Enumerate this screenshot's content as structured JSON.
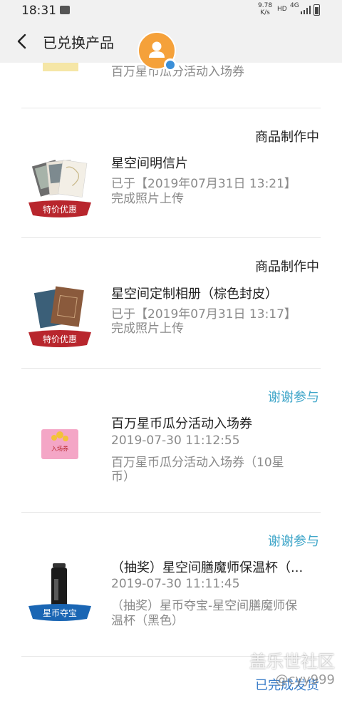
{
  "status_bar": {
    "time": "18:31",
    "speed_value": "9.78",
    "speed_unit": "K/s",
    "hd": "HD",
    "network": "4G"
  },
  "header": {
    "title": "已兑换产品"
  },
  "items": [
    {
      "line": "百万星币瓜分活动入场券"
    },
    {
      "status": "商品制作中",
      "title": "星空间明信片",
      "line1": "已于【2019年07月31日 13:21】",
      "line2": "完成照片上传",
      "badge": "特价优惠"
    },
    {
      "status": "商品制作中",
      "title": "星空间定制相册（棕色封皮）",
      "line1": "已于【2019年07月31日 13:17】",
      "line2": "完成照片上传",
      "badge": "特价优惠"
    },
    {
      "status": "谢谢参与",
      "title": "百万星币瓜分活动入场券",
      "date": "2019-07-30 11:12:55",
      "line1": "百万星币瓜分活动入场券（10星",
      "line2": "币）",
      "ticket_text": "入场券"
    },
    {
      "status": "谢谢参与",
      "title": "（抽奖）星空间膳魔师保温杯（...",
      "date": "2019-07-30 11:11:45",
      "line1": "（抽奖）星币夺宝-星空间膳魔师保",
      "line2": "温杯（黑色）",
      "badge": "星币夺宝"
    },
    {
      "status": "已完成发货"
    }
  ],
  "watermark": {
    "line1": "盖乐世社区",
    "line2": "@cyy999"
  },
  "colors": {
    "header_bg": "#f1f1f1",
    "badge_red": "#b8262d",
    "badge_blue": "#1a66b4",
    "status_blue": "#3fa6c9",
    "avatar": "#f5a13a"
  }
}
